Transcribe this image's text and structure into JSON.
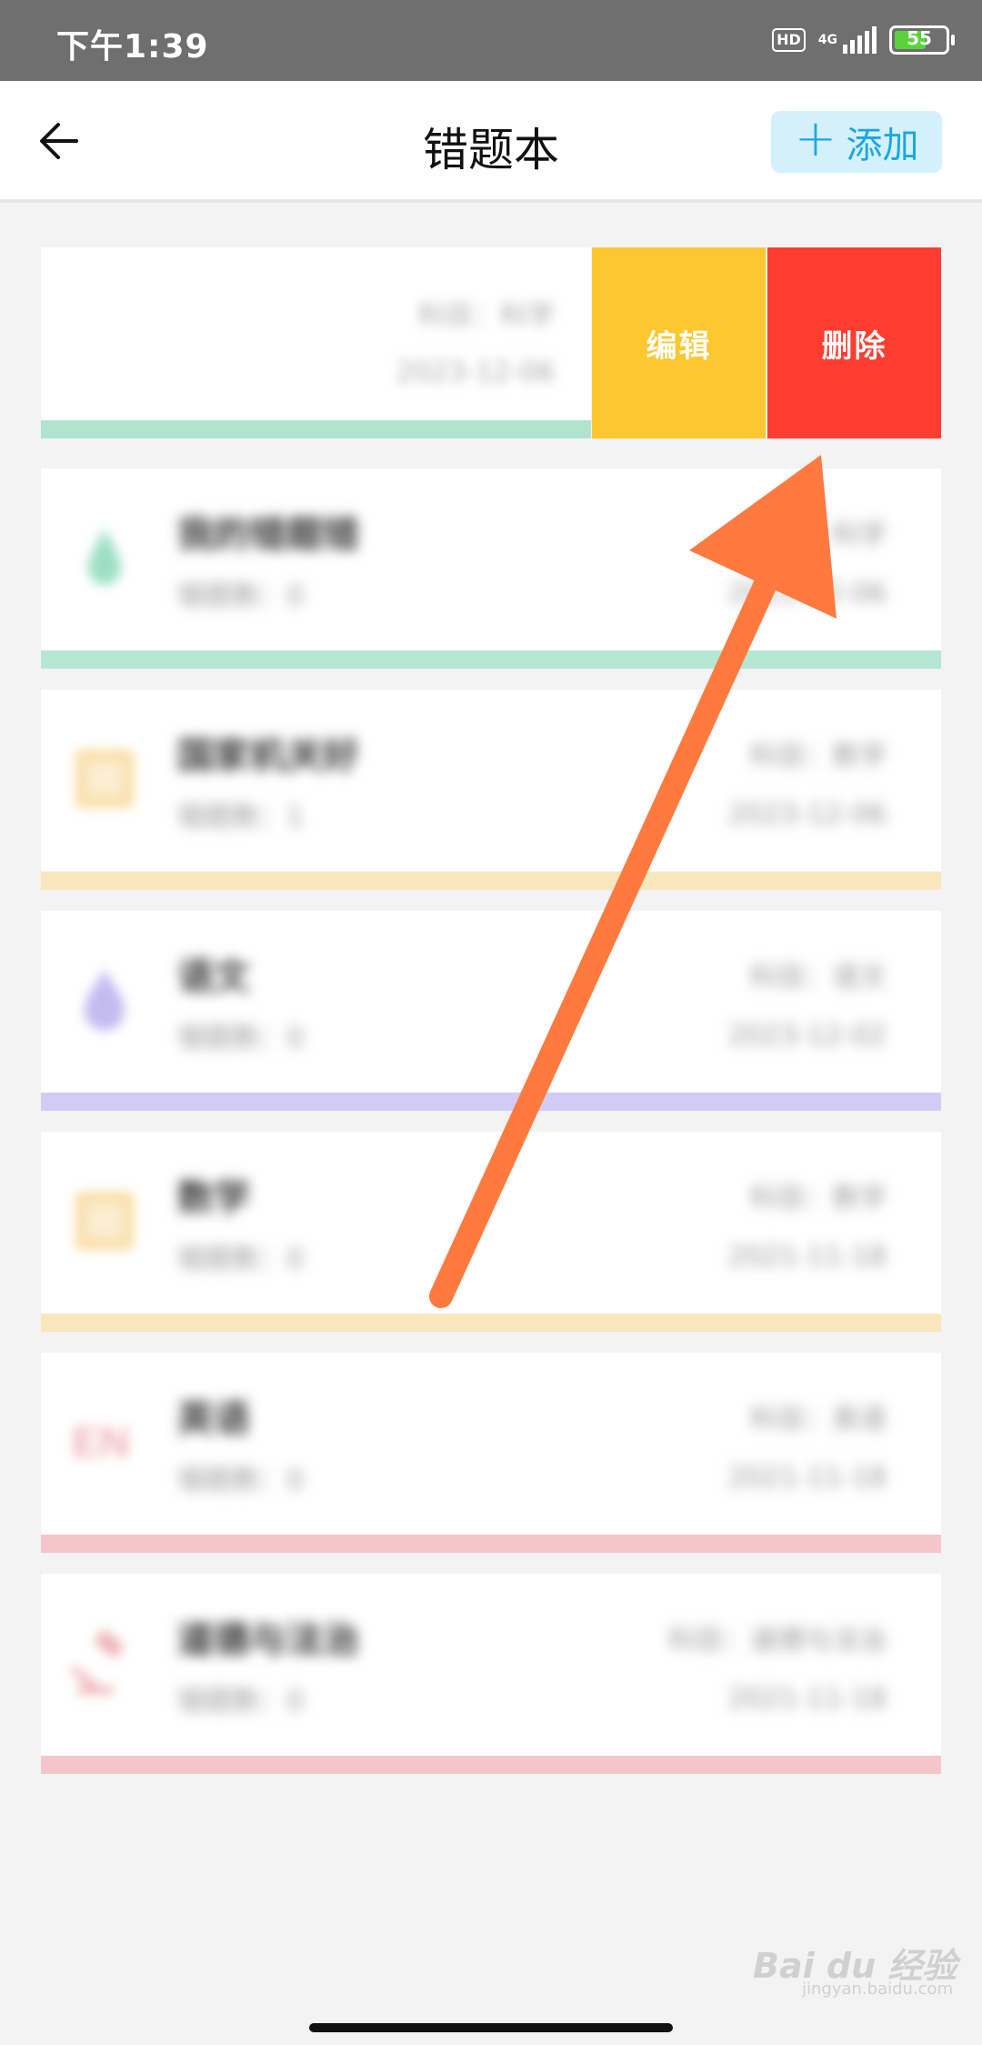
{
  "status_bar": {
    "time": "下午1:39",
    "hd": "HD",
    "network": "4G",
    "battery": "55"
  },
  "header": {
    "title": "错题本",
    "add_label": "添加"
  },
  "swiped_item": {
    "subject": "科目：科学",
    "date": "2023-12-06",
    "edit_label": "编辑",
    "delete_label": "删除"
  },
  "items": [
    {
      "name": "我的错题错",
      "count": "错题数：0",
      "subject": "科目：科学",
      "date": "2023-12-06",
      "color": "#5cc9a0",
      "icon": "flask-icon"
    },
    {
      "name": "国家机关好",
      "count": "错题数：1",
      "subject": "科目：数学",
      "date": "2023-12-06",
      "color": "#f4c76a",
      "icon": "math-icon"
    },
    {
      "name": "语文",
      "count": "错题数：0",
      "subject": "科目：语文",
      "date": "2023-12-02",
      "color": "#9b8ee6",
      "icon": "ink-drop-icon"
    },
    {
      "name": "数学",
      "count": "错题数：0",
      "subject": "科目：数学",
      "date": "2021-11-18",
      "color": "#f4c76a",
      "icon": "math-icon"
    },
    {
      "name": "英语",
      "count": "错题数：0",
      "subject": "科目：英语",
      "date": "2021-11-18",
      "color": "#e5808a",
      "icon": "en-icon"
    },
    {
      "name": "道德与法治",
      "count": "错题数：0",
      "subject": "科目：道德与法治",
      "date": "2021-11-18",
      "color": "#e5808a",
      "icon": "gavel-icon"
    }
  ],
  "watermark": {
    "brand": "Bai du 经验",
    "url": "jingyan.baidu.com"
  },
  "colors": {
    "accent": "#1ba7e0",
    "edit": "#fdc730",
    "delete": "#fe3d31",
    "annotation_arrow": "#ff7a3f"
  }
}
